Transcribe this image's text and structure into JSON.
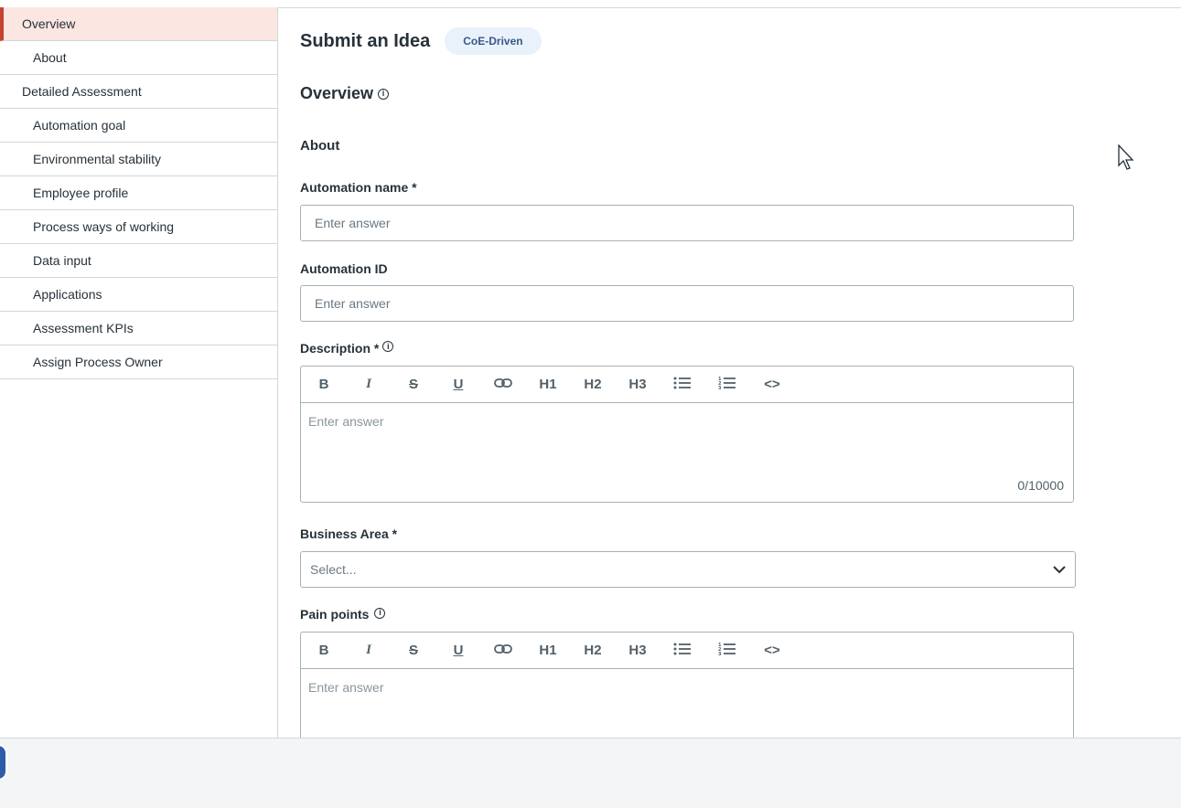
{
  "sidebar": {
    "items": [
      {
        "label": "Overview"
      },
      {
        "label": "About"
      },
      {
        "label": "Detailed Assessment"
      },
      {
        "label": "Automation goal"
      },
      {
        "label": "Environmental stability"
      },
      {
        "label": "Employee profile"
      },
      {
        "label": "Process ways of working"
      },
      {
        "label": "Data input"
      },
      {
        "label": "Applications"
      },
      {
        "label": "Assessment KPIs"
      },
      {
        "label": "Assign Process Owner"
      }
    ]
  },
  "header": {
    "title": "Submit an Idea",
    "badge": "CoE-Driven"
  },
  "form": {
    "section_title": "Overview",
    "subsection_title": "About",
    "automation_name": {
      "label": "Automation name *",
      "placeholder": "Enter answer"
    },
    "automation_id": {
      "label": "Automation ID",
      "placeholder": "Enter answer"
    },
    "description": {
      "label": "Description *",
      "placeholder": "Enter answer",
      "counter": "0/10000"
    },
    "business_area": {
      "label": "Business Area *",
      "placeholder": "Select..."
    },
    "pain_points": {
      "label": "Pain points",
      "placeholder": "Enter answer"
    }
  },
  "toolbar": {
    "bold": "B",
    "italic": "I",
    "strike": "S",
    "underline": "U",
    "h1": "H1",
    "h2": "H2",
    "h3": "H3",
    "code": "<>"
  },
  "icons": {
    "info": "info-icon",
    "link": "link-icon",
    "bullet_list": "bullet-list-icon",
    "numbered_list": "numbered-list-icon",
    "chevron": "chevron-down-icon",
    "cursor": "mouse-cursor-icon"
  },
  "colors": {
    "accent": "#c2452d",
    "active_bg": "#fbe6e1",
    "badge_bg": "#e9f1fa",
    "badge_text": "#38598b"
  }
}
